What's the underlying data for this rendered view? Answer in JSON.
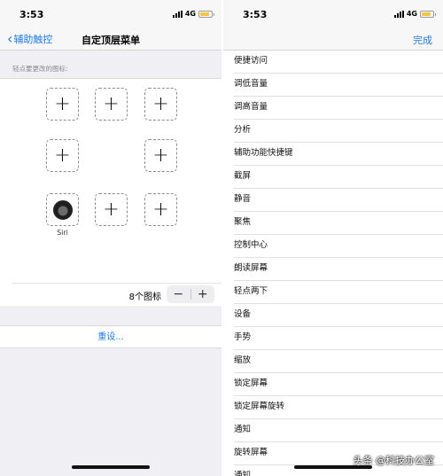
{
  "left_screen": {
    "status": {
      "time": "3:53",
      "network": "4G"
    },
    "nav": {
      "back_label": "辅助触控",
      "title": "自定顶层菜单"
    },
    "hint": "轻点要更改的图标:",
    "slots": [
      {
        "icon": "plus"
      },
      {
        "icon": "plus"
      },
      {
        "icon": "plus"
      },
      {
        "icon": "plus"
      },
      {
        "icon": "plus"
      },
      {
        "icon": "siri",
        "label": "Siri"
      },
      {
        "icon": "plus"
      },
      {
        "icon": "plus"
      }
    ],
    "count_label": "8个图标",
    "stepper": {
      "minus": "−",
      "plus": "+"
    },
    "reset": "重设..."
  },
  "right_screen": {
    "status": {
      "time": "3:53",
      "network": "4G"
    },
    "nav": {
      "done_label": "完成"
    },
    "actions": [
      "便捷访问",
      "调低音量",
      "调高音量",
      "分析",
      "辅助功能快捷键",
      "截屏",
      "静音",
      "聚焦",
      "控制中心",
      "朗读屏幕",
      "轻点两下",
      "设备",
      "手势",
      "缩放",
      "锁定屏幕",
      "锁定屏幕旋转",
      "通知",
      "旋转屏幕",
      "通知..."
    ]
  },
  "watermark": "头条 @科技办公室",
  "colors": {
    "accent": "#1f7cf0",
    "battery": "#f5c542"
  }
}
